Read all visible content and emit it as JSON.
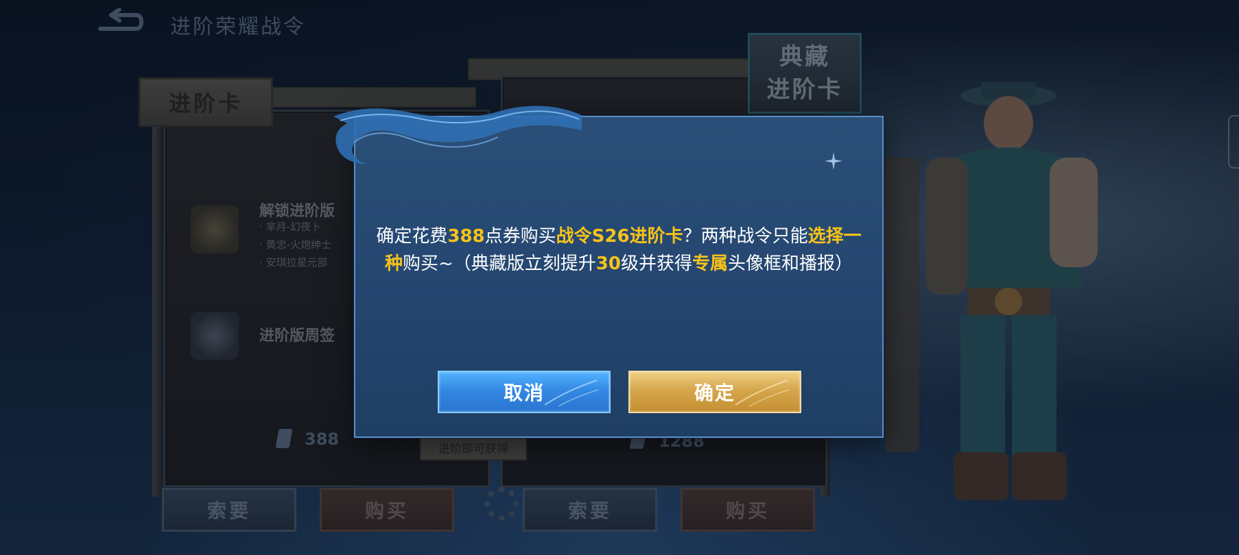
{
  "header": {
    "title": "进阶荣耀战令"
  },
  "left_card": {
    "plaque": "进阶卡",
    "feature1_title": "解锁进阶版",
    "feature1_lines": [
      "· 芈月-幻夜卜",
      "· 黄忠-火炮绅士",
      "· 安琪拉星元部"
    ],
    "feature2_title": "进阶版周签",
    "price": "388",
    "ask_label": "索要",
    "buy_label": "购买"
  },
  "center_tag": "进阶即可获得",
  "right_card": {
    "plaque_line1": "典藏",
    "plaque_line2": "进阶卡",
    "price": "1288",
    "ask_label": "索要",
    "buy_label": "购买"
  },
  "dialog": {
    "message_parts": {
      "p1": "确定花费",
      "cost": "388",
      "p2": "点券购买",
      "item": "战令S26进阶卡",
      "p3": "？两种战令只能",
      "choice": "选择一种",
      "p4": "购买~（典藏版立刻提升",
      "levels": "30",
      "p5": "级并获得",
      "exclusive": "专属",
      "p6": "头像框和播报）"
    },
    "cancel_label": "取消",
    "confirm_label": "确定"
  },
  "colors": {
    "highlight": "#f7c21a",
    "cancel_button": "#3389e3",
    "confirm_button": "#d6a64c",
    "dialog_bg": "#244670"
  }
}
